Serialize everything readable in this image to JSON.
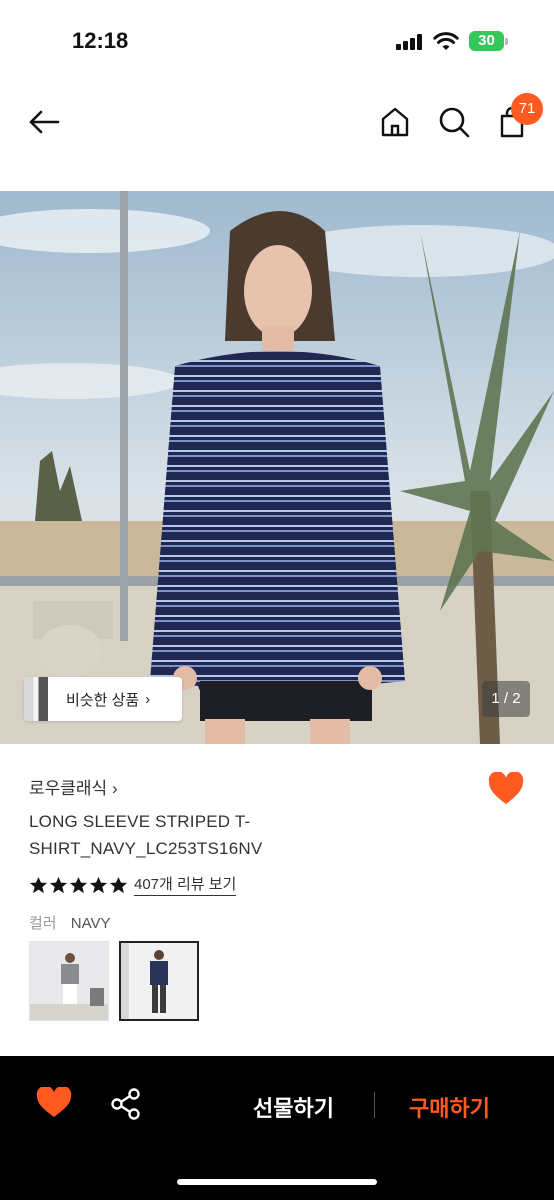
{
  "status_bar": {
    "time": "12:18",
    "battery": "30"
  },
  "nav": {
    "cart_count": "71"
  },
  "gallery": {
    "similar_label": "비슷한 상품",
    "page_indicator": "1 / 2"
  },
  "product": {
    "brand": "로우클래식",
    "title": "LONG SLEEVE STRIPED T-SHIRT_NAVY_LC253TS16NV",
    "rating_stars": 5,
    "reviews_label": "407개 리뷰 보기",
    "color_label": "컬러",
    "color_value": "NAVY"
  },
  "bottom_bar": {
    "gift_label": "선물하기",
    "buy_label": "구매하기"
  },
  "colors": {
    "accent": "#ff5a1f",
    "battery": "#34c759",
    "bottom_bg": "#000000"
  }
}
